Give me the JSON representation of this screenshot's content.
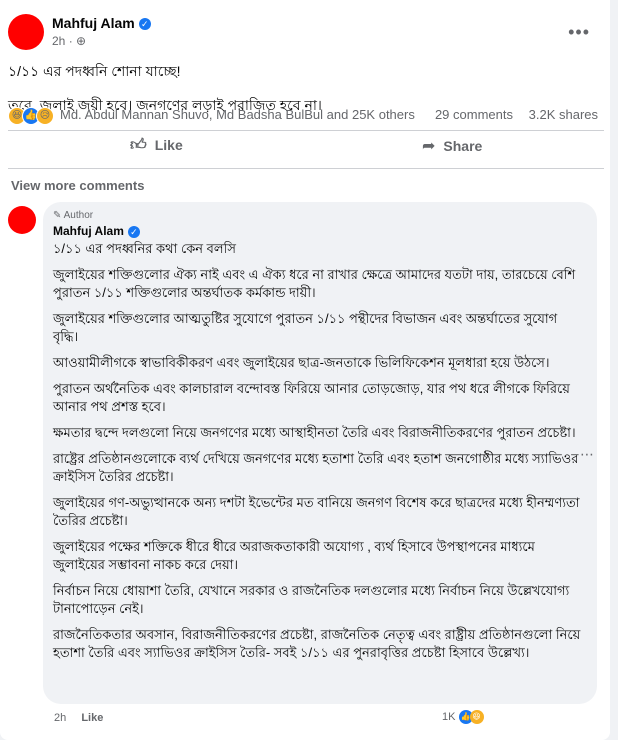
{
  "post": {
    "author_name": "Mahfuj Alam",
    "time": "2h",
    "privacy_icon": "globe-icon",
    "more_glyph": "•••",
    "lines": [
      "১/১১ এর পদধ্বনি শোনা যাচ্ছে!",
      "তবে, জুলাই জয়ী হবে। জনগণের লড়াই পরাজিত হবে না।"
    ],
    "reactors_text": "Md. Abdul Mannan Shuvo, Md Badsha BulBul and 25K others",
    "comments_count": "29 comments",
    "shares_count": "3.2K shares",
    "like_label": "Like",
    "share_label": "Share"
  },
  "comments": {
    "view_more_label": "View more comments",
    "items": [
      {
        "author_tag": "Author",
        "author_name": "Mahfuj Alam",
        "first_line": "১/১১ এর পদধ্বনির কথা কেন বলসি",
        "paragraphs": [
          "জুলাইয়ের শক্তিগুলোর ঐক্য নাই এবং এ ঐক্য ধরে না রাখার ক্ষেত্রে আমাদের যতটা দায়, তারচেয়ে বেশি পুরাতন ১/১১ শক্তিগুলোর অন্তর্ঘাতক কর্মকান্ড দায়ী।",
          "জুলাইয়ের শক্তিগুলোর আত্মতুষ্টির সুযোগে পুরাতন ১/১১ পন্থীদের বিভাজন এবং অন্তর্ঘাতের সুযোগ বৃদ্ধি।",
          "আওয়ামীলীগকে স্বাভাবিকীকরণ এবং জুলাইয়ের ছাত্র-জনতাকে ভিলিফিকেশন মূলধারা হয়ে উঠসে।",
          "পুরাতন অর্থনৈতিক এবং কালচারাল বন্দোবস্ত ফিরিয়ে আনার তোড়জোড়, যার পথ ধরে লীগকে ফিরিয়ে আনার পথ প্রশস্ত হবে।",
          "ক্ষমতার দ্বন্দে দলগুলো নিয়ে জনগণের মধ্যে আস্থাহীনতা তৈরি এবং বিরাজনীতিকরণের পুরাতন প্রচেষ্টা।",
          "রাষ্ট্রের প্রতিষ্ঠানগুলোকে ব্যর্থ দেখিয়ে জনগণের মধ্যে হতাশা তৈরি এবং হতাশ জনগোষ্ঠীর মধ্যে স্যাভিওর ক্রাইসিস তৈরির প্রচেষ্টা।",
          "জুলাইয়ের গণ-অভ্যুত্থানকে অন্য দশটা ইভেন্টের মত বানিয়ে জনগণ বিশেষ করে ছাত্রদের মধ্যে হীনম্মণ্যতা তৈরির প্রচেষ্টা।",
          "জুলাইয়ের পক্ষের শক্তিকে ধীরে ধীরে অরাজকতাকারী অযোগ্য , ব্যর্থ হিসাবে উপস্থাপনের মাধ্যমে জুলাইয়ের সম্ভাবনা নাকচ করে দেয়া।",
          "নির্বাচন নিয়ে ধোয়াশা তৈরি, যেখানে সরকার ও রাজনৈতিক দলগুলোর মধ্যে নির্বাচন নিয়ে উল্লেখযোগ্য টানাপোড়েন নেই।",
          "রাজনৈতিকতার অবসান, বিরাজনীতিকরণের প্রচেষ্টা, রাজনৈতিক নেতৃত্ব এবং রাষ্ট্রীয় প্রতিষ্ঠানগুলো নিয়ে হতাশা তৈরি এবং স্যাভিওর ক্রাইসিস তৈরি- সবই ১/১১ এর পুনরাবৃত্তির প্রচেষ্টা হিসাবে উল্লেখ্য।"
        ],
        "time": "2h",
        "like_label": "Like",
        "reaction_count": "1K"
      }
    ]
  },
  "colors": {
    "avatar": "#ff0000",
    "accent": "#1877f2",
    "secondary_text": "#65676b",
    "bubble_bg": "#f0f2f5"
  }
}
